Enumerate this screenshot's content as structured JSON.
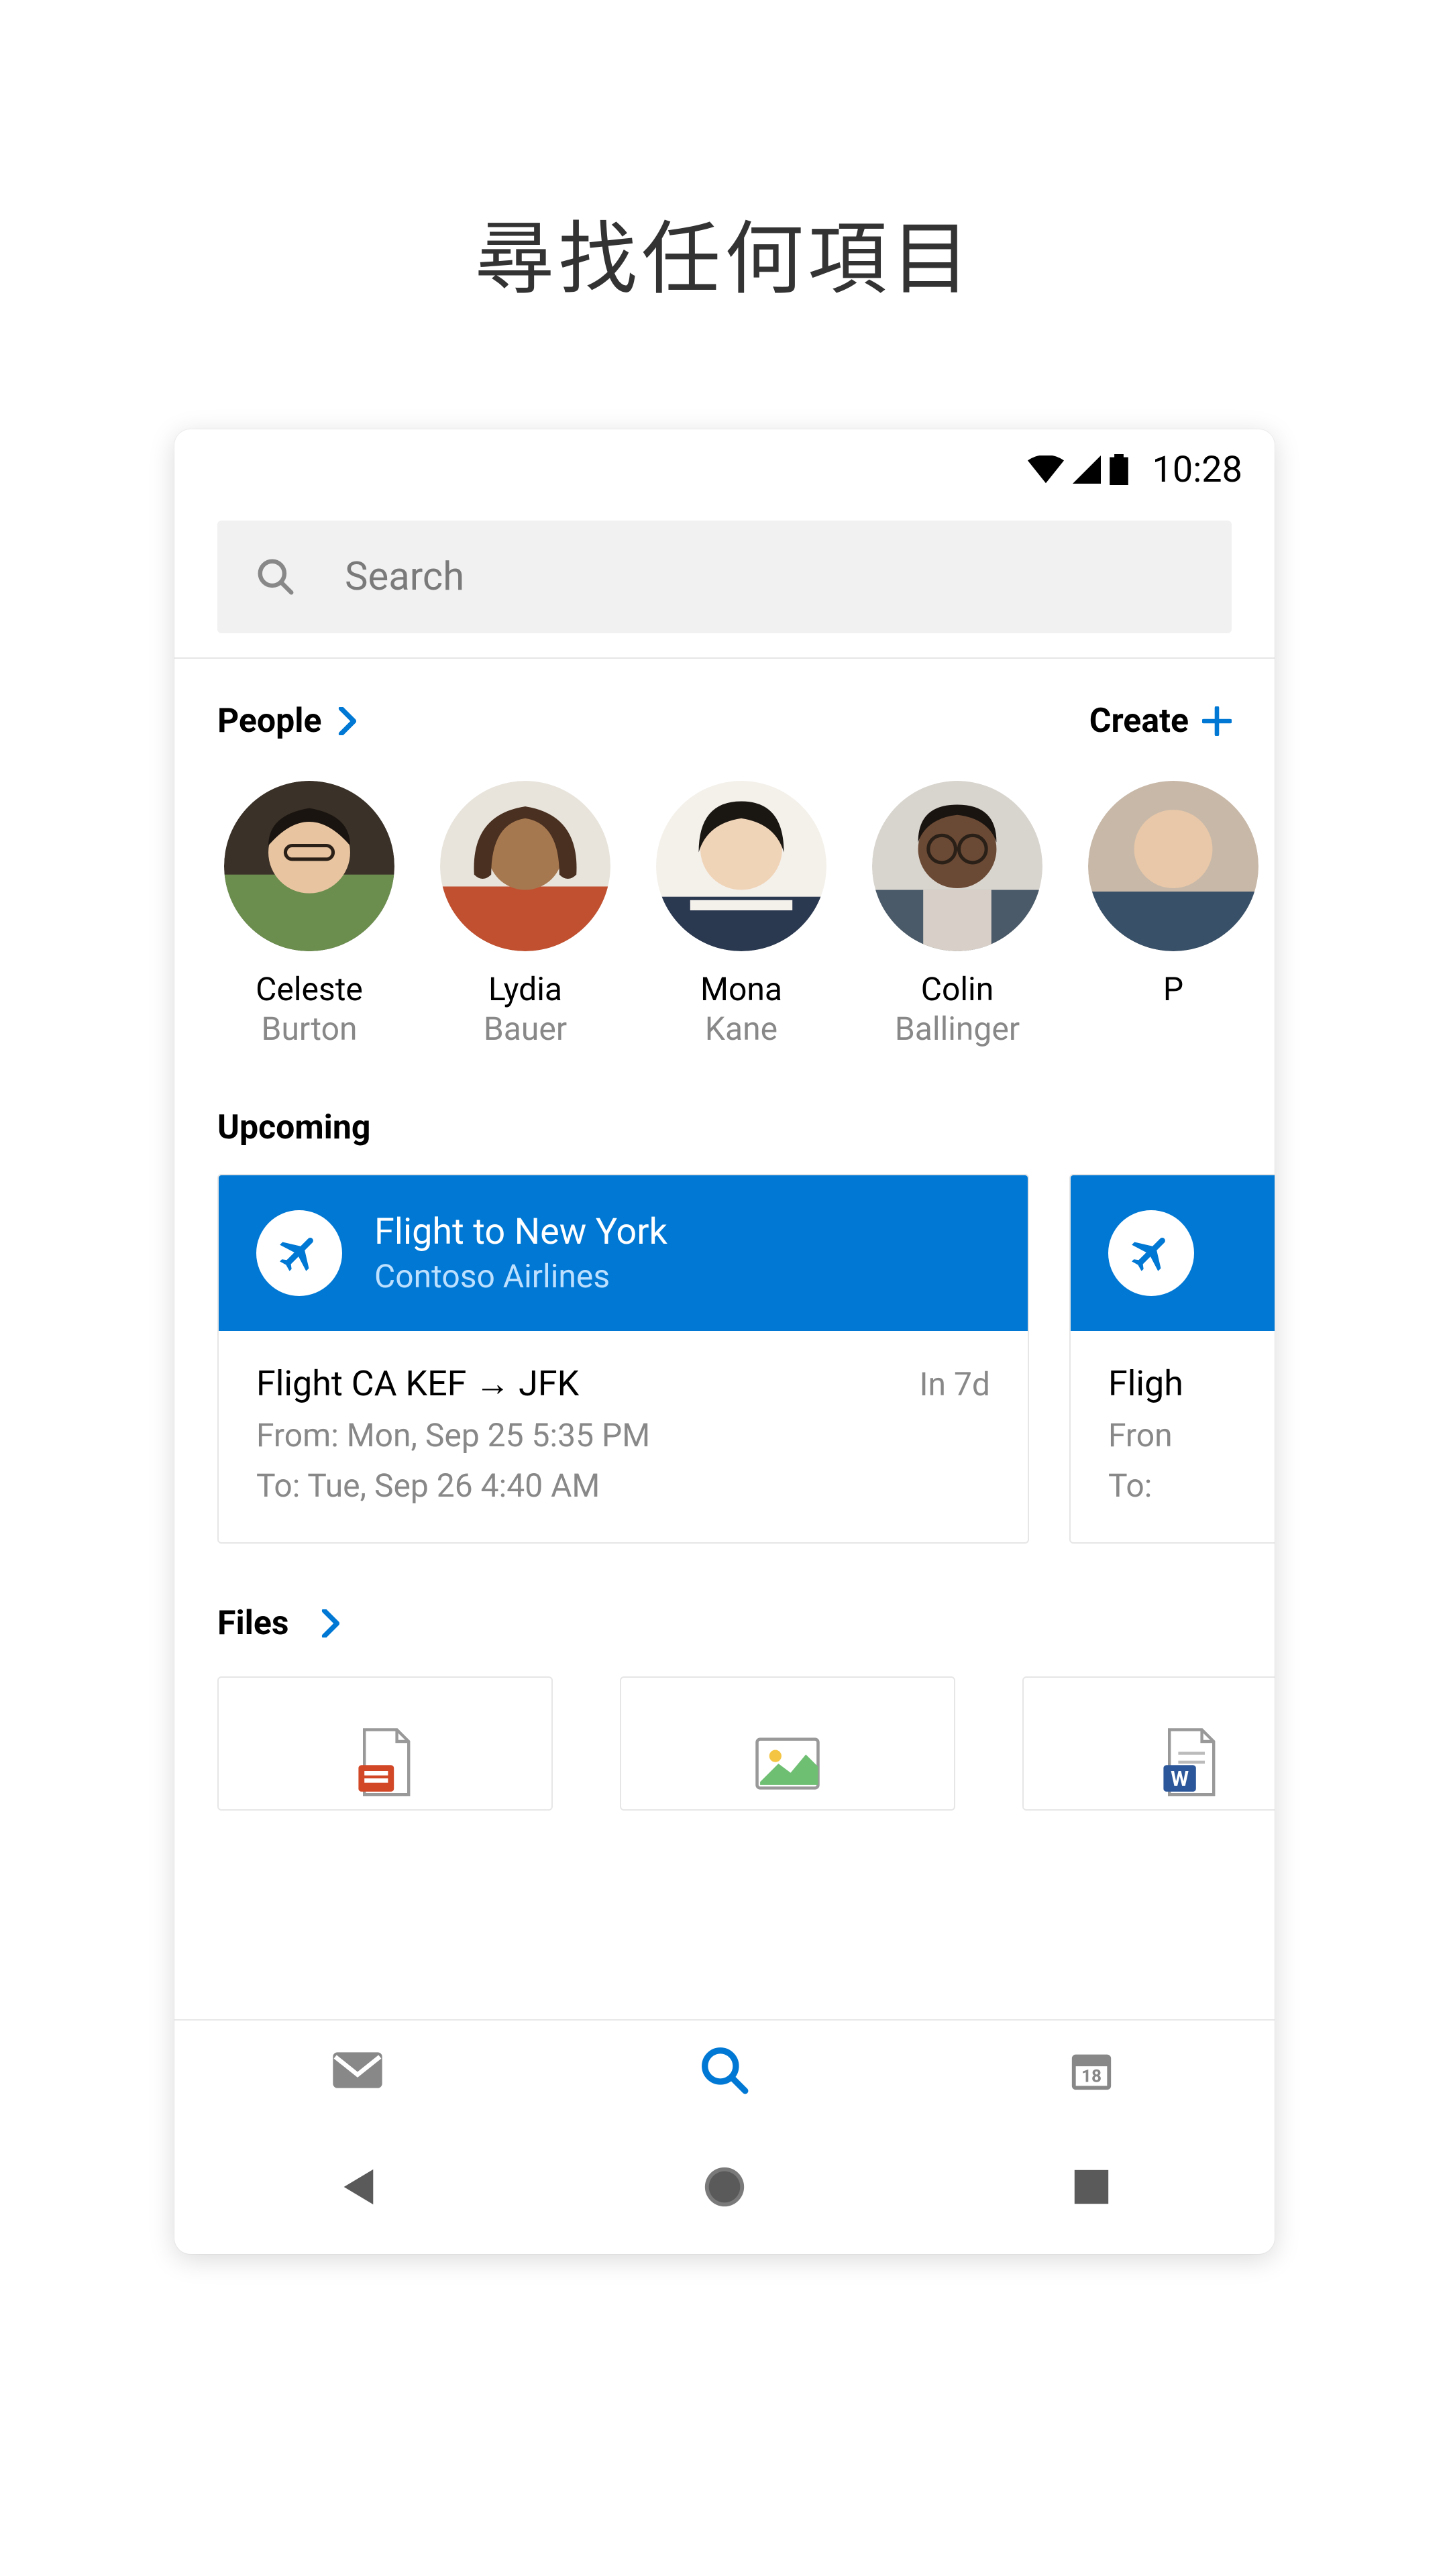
{
  "headline": "尋找任何項目",
  "status": {
    "time": "10:28"
  },
  "search": {
    "placeholder": "Search"
  },
  "sections": {
    "people_label": "People",
    "create_label": "Create",
    "upcoming_label": "Upcoming",
    "files_label": "Files"
  },
  "people": [
    {
      "first": "Celeste",
      "last": "Burton"
    },
    {
      "first": "Lydia",
      "last": "Bauer"
    },
    {
      "first": "Mona",
      "last": "Kane"
    },
    {
      "first": "Colin",
      "last": "Ballinger"
    },
    {
      "first": "P",
      "last": ""
    }
  ],
  "upcoming": [
    {
      "title": "Flight to New York",
      "subtitle": "Contoso Airlines",
      "route": "Flight CA KEF → JFK",
      "eta": "In 7d",
      "from": "From: Mon, Sep 25 5:35 PM",
      "to": "To: Tue, Sep 26 4:40 AM"
    },
    {
      "title": "",
      "subtitle": "",
      "route": "Fligh",
      "eta": "",
      "from": "Fron",
      "to": "To:"
    }
  ],
  "files": [
    {
      "type": "powerpoint-icon"
    },
    {
      "type": "image-icon"
    },
    {
      "type": "word-icon"
    }
  ],
  "tabs": {
    "mail": "mail-icon",
    "search": "search-icon",
    "calendar": "calendar-icon",
    "calendar_day": "18"
  },
  "colors": {
    "accent": "#0078d4",
    "muted": "#888888"
  }
}
